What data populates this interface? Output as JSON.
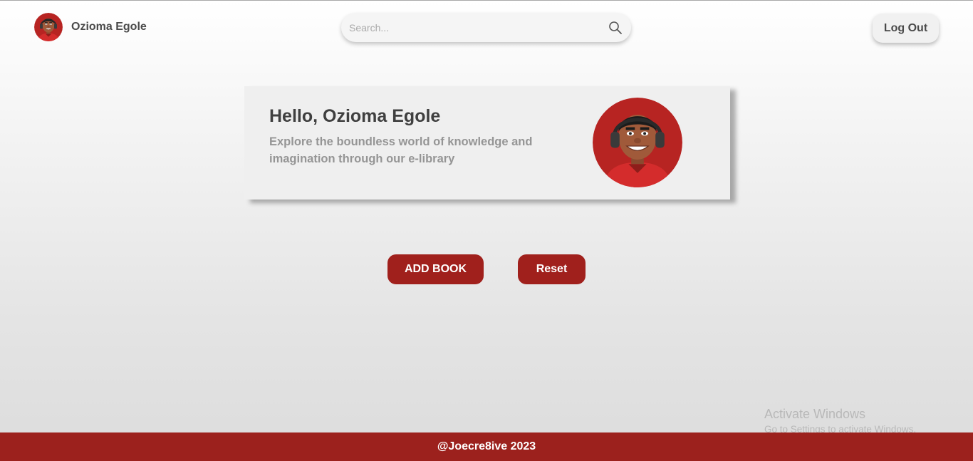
{
  "header": {
    "user_name": "Ozioma Egole",
    "search_placeholder": "Search...",
    "logout_label": "Log Out"
  },
  "hero": {
    "title": "Hello, Ozioma Egole",
    "text": "Explore the boundless world of knowledge and imagination through our e-library"
  },
  "actions": {
    "add_book_label": "ADD BOOK",
    "reset_label": "Reset"
  },
  "watermark": {
    "title": "Activate Windows",
    "subtitle": "Go to Settings to activate Windows."
  },
  "footer": {
    "credit": "@Joecre8ive 2023"
  },
  "icons": {
    "search": "search-icon",
    "avatar": "avatar-cartoon"
  },
  "colors": {
    "accent": "#9c211d",
    "card_bg": "#efefef",
    "text_dark": "#3f3f3f",
    "text_muted": "#959595"
  }
}
